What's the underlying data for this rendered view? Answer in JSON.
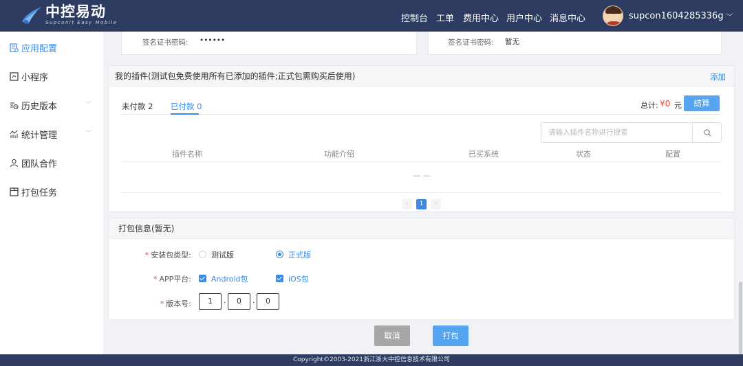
{
  "header": {
    "logo_cn": "中控易动",
    "logo_en": "Supconit Easy Mobile",
    "nav": [
      "控制台",
      "工单",
      "费用中心",
      "用户中心",
      "消息中心"
    ],
    "username": "supcon1604285336g",
    "colors": {
      "header_bg": "#2c3b5f",
      "accent": "#3b8ae6"
    }
  },
  "sidebar": {
    "items": [
      {
        "label": "应用配置",
        "icon": "app-config-icon",
        "active": true
      },
      {
        "label": "小程序",
        "icon": "mini-program-icon"
      },
      {
        "label": "历史版本",
        "icon": "history-icon",
        "expandable": true
      },
      {
        "label": "统计管理",
        "icon": "statistics-icon",
        "expandable": true
      },
      {
        "label": "团队合作",
        "icon": "team-icon"
      },
      {
        "label": "打包任务",
        "icon": "package-task-icon"
      }
    ]
  },
  "cert": {
    "left_label": "签名证书密码:",
    "left_value": "••••••",
    "right_label": "签名证书密码:",
    "right_value": "暂无"
  },
  "plugins": {
    "title": "我的插件(测试包免费使用所有已添加的插件;正式包需购买后使用)",
    "add_label": "添加",
    "tabs": [
      {
        "label": "未付款 2",
        "active": false
      },
      {
        "label": "已付款 0",
        "active": true
      }
    ],
    "total_label": "总计:",
    "total_amount": "¥0",
    "total_unit": "元",
    "checkout_label": "结算",
    "search_placeholder": "请输入插件名称进行搜索",
    "columns": [
      "插件名称",
      "功能介绍",
      "已买系统",
      "状态",
      "配置"
    ],
    "empty_text": "— —",
    "pager": {
      "prev": "‹",
      "current": "1",
      "next": "›"
    }
  },
  "package": {
    "title": "打包信息(暂无)",
    "type_label": "安装包类型:",
    "type_options": [
      {
        "label": "测试版",
        "selected": false
      },
      {
        "label": "正式版",
        "selected": true
      }
    ],
    "platform_label": "APP平台:",
    "platform_options": [
      {
        "label": "Android包",
        "checked": true
      },
      {
        "label": "iOS包",
        "checked": true
      }
    ],
    "version_label": "版本号:",
    "version": [
      "1",
      "0",
      "0"
    ],
    "required_mark": "*",
    "dot": "."
  },
  "actions": {
    "cancel_label": "取消",
    "build_label": "打包"
  },
  "footer": {
    "copyright": "Copyright©2003-2021浙江浙大中控信息技术有限公司"
  }
}
